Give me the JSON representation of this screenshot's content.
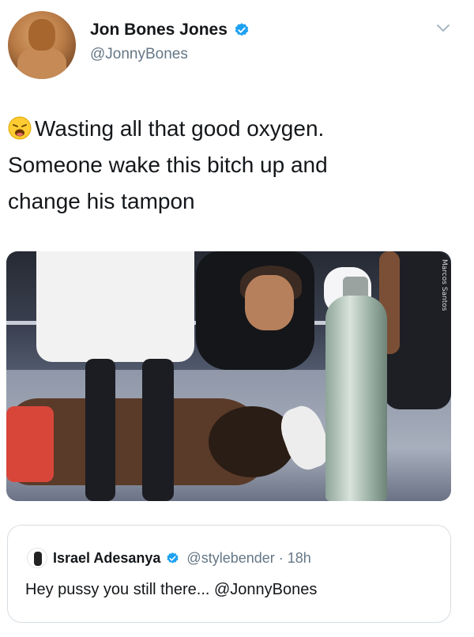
{
  "author": {
    "display_name": "Jon Bones Jones",
    "handle": "@JonnyBones",
    "verified": true
  },
  "tweet": {
    "emoji": "weary-face-emoji",
    "text_line_1": "Wasting all that good oxygen.",
    "text_line_2": "Someone wake this bitch up and",
    "text_line_3": "change his tampon"
  },
  "photo": {
    "watermark": "Marcos Santos"
  },
  "quoted_tweet": {
    "display_name": "Israel Adesanya",
    "verified": true,
    "handle_and_time": "@stylebender · 18h",
    "text": "Hey pussy you still there... @JonnyBones"
  },
  "colors": {
    "verified_blue": "#1da1f2",
    "secondary_text": "#657786",
    "primary_text": "#14171a",
    "border": "#d7dde2"
  },
  "icons": [
    "verified-badge-icon",
    "chevron-down-icon",
    "weary-face-emoji"
  ]
}
